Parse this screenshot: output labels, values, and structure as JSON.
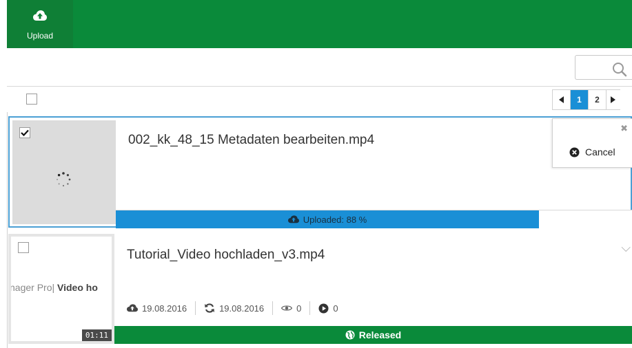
{
  "toolbar": {
    "upload_label": "Upload"
  },
  "search": {
    "placeholder": ""
  },
  "pagination": {
    "pages": [
      "1",
      "2"
    ],
    "active": "1"
  },
  "items": [
    {
      "title": "002_kk_48_15 Metadaten bearbeiten.mp4",
      "checked": true,
      "progress": {
        "label": "Uploaded: 88 %",
        "percent": 88
      },
      "menu": {
        "cancel_label": "Cancel"
      }
    },
    {
      "title": "Tutorial_Video hochladen_v3.mp4",
      "checked": false,
      "thumbnail_text_a": "nager Pro",
      "thumbnail_text_b": "Video ho",
      "duration": "01:11",
      "uploaded_date": "19.08.2016",
      "updated_date": "19.08.2016",
      "views": "0",
      "plays": "0",
      "status": "Released"
    }
  ],
  "colors": {
    "brand_green": "#0a8a3a",
    "progress_blue": "#1a8fd6"
  },
  "icons": [
    "cloud-upload-icon",
    "search-icon",
    "chevron-left-icon",
    "chevron-right-icon",
    "close-icon",
    "cancel-icon",
    "spinner-icon",
    "refresh-icon",
    "eye-icon",
    "play-icon",
    "globe-icon",
    "chevron-down-icon",
    "check-icon"
  ]
}
